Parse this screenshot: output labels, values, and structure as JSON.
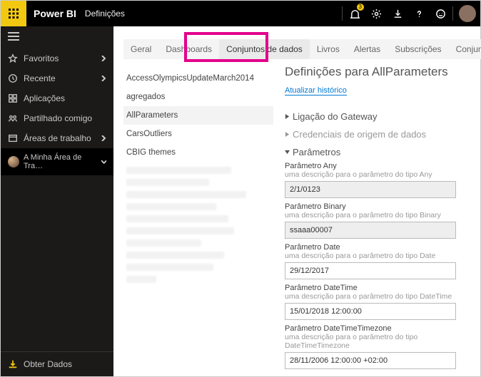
{
  "top": {
    "brand": "Power BI",
    "breadcrumb": "Definições",
    "notif_badge": "3"
  },
  "nav": {
    "favoritos": "Favoritos",
    "recente": "Recente",
    "aplicacoes": "Aplicações",
    "partilhado": "Partilhado comigo",
    "areas": "Áreas de trabalho",
    "minhaarea": "A Minha Área de Tra…",
    "obter": "Obter Dados"
  },
  "tabs": {
    "geral": "Geral",
    "dashboards": "Dashboards",
    "conjuntos": "Conjuntos de dados",
    "livros": "Livros",
    "alertas": "Alertas",
    "subscricoes": "Subscrições",
    "conjuntos2": "Conjuntos de dados"
  },
  "datasets": {
    "d0": "AccessOlympicsUpdateMarch2014",
    "d1": "agregados",
    "d2": "AllParameters",
    "d3": "CarsOutliers",
    "d4": "CBIG themes"
  },
  "detail": {
    "title": "Definições para AllParameters",
    "refresh": "Atualizar histórico",
    "gateway": "Ligação do Gateway",
    "creds": "Credenciais de origem de dados",
    "params": "Parâmetros",
    "pAny": {
      "label": "Parâmetro Any",
      "desc": "uma descrição para o parâmetro do tipo Any",
      "value": "2/1/0123"
    },
    "pBinary": {
      "label": "Parâmetro Binary",
      "desc": "uma descrição para o parâmetro do tipo Binary",
      "value": "ssaaa00007"
    },
    "pDate": {
      "label": "Parâmetro Date",
      "desc": "uma descrição para o parâmetro do tipo Date",
      "value": "29/12/2017"
    },
    "pDateTime": {
      "label": "Parâmetro DateTime",
      "desc": "uma descrição para o parâmetro do tipo DateTime",
      "value": "15/01/2018 12:00:00"
    },
    "pDTTZ": {
      "label": "Parâmetro DateTimeTimezone",
      "desc": "uma descrição para o parâmetro do tipo DateTimeTimezone",
      "value": "28/11/2006 12:00:00 +02:00"
    }
  }
}
